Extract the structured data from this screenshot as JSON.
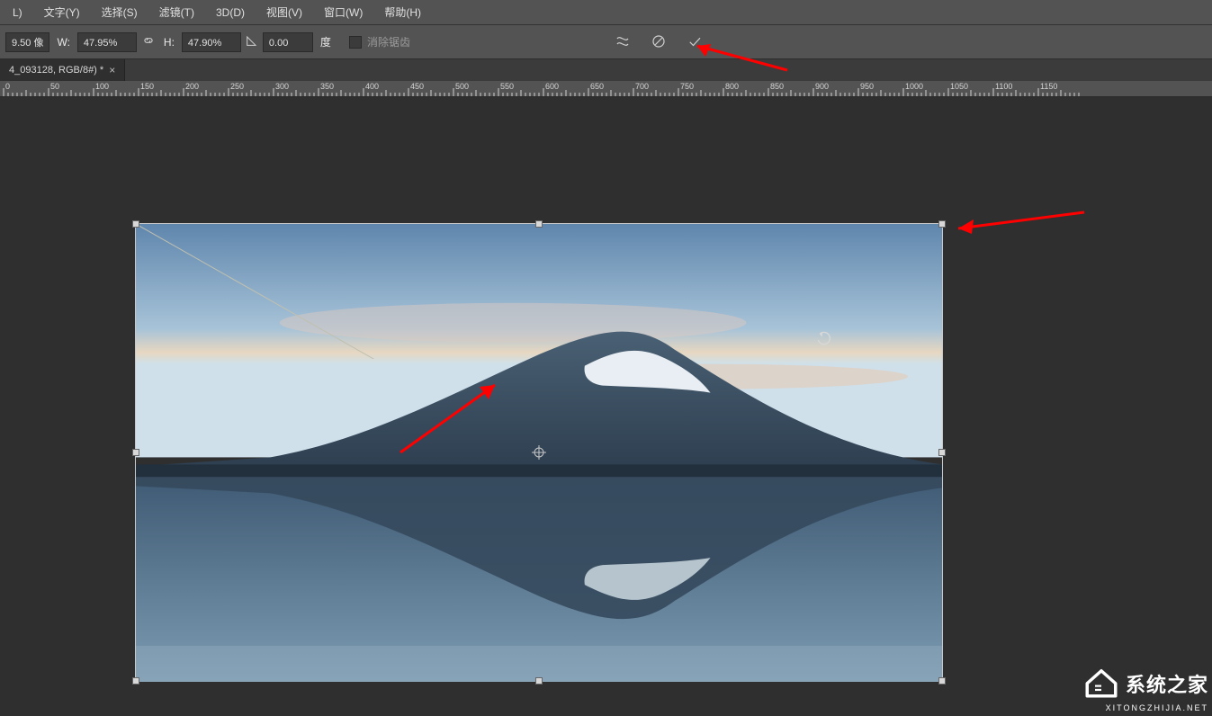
{
  "menu": {
    "items": [
      "L)",
      "文字(Y)",
      "选择(S)",
      "滤镜(T)",
      "3D(D)",
      "视图(V)",
      "窗口(W)",
      "帮助(H)"
    ]
  },
  "options": {
    "size_unit": "9.50 像",
    "w_label": "W:",
    "w_value": "47.95%",
    "link_icon": "link-icon",
    "h_label": "H:",
    "h_value": "47.90%",
    "angle_icon": "angle-icon",
    "angle_value": "0.00",
    "angle_unit": "度",
    "antialias_label": "消除锯齿",
    "warp_icon": "warp-icon",
    "cancel_icon": "cancel-icon",
    "confirm_icon": "confirm-icon"
  },
  "tab": {
    "label": "4_093128, RGB/8#) *",
    "close": "×"
  },
  "ruler": {
    "ticks": [
      0,
      50,
      100,
      150,
      200,
      250,
      300,
      350,
      400,
      450,
      500,
      550,
      600,
      650,
      700,
      750,
      800,
      850,
      900,
      950,
      1000,
      1050,
      1100,
      1150
    ]
  },
  "cursor": {
    "icon": "rotate-cursor-icon"
  },
  "watermark": {
    "main": "系统之家",
    "sub": "XITONGZHIJIA.NET",
    "icon": "house-icon"
  }
}
